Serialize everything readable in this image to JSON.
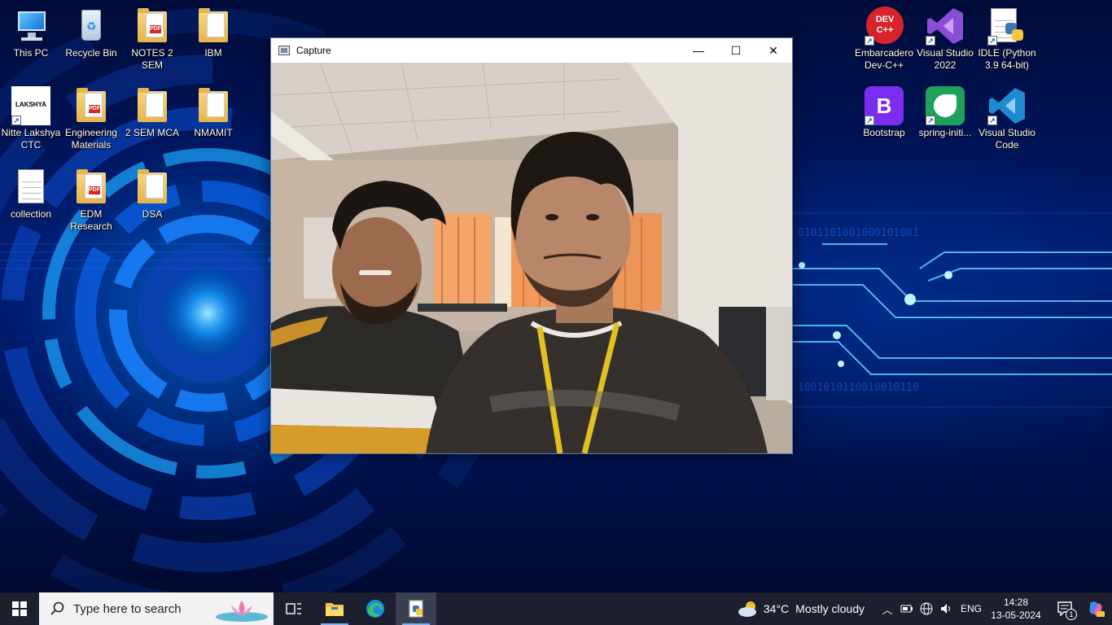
{
  "desktop": {
    "left_icons": [
      {
        "label": "This PC",
        "icon": "this-pc-icon"
      },
      {
        "label": "Recycle Bin",
        "icon": "recycle-bin-icon"
      },
      {
        "label": "NOTES 2 SEM",
        "icon": "pdf-folder-icon"
      },
      {
        "label": "IBM",
        "icon": "folder-icon"
      },
      {
        "label": "Nitte Lakshya CTC",
        "icon": "lakshya-shortcut-icon",
        "logo_text": "LAKSHYA"
      },
      {
        "label": "Engineering Materials",
        "icon": "pdf-folder-icon"
      },
      {
        "label": "2 SEM MCA",
        "icon": "folder-icon"
      },
      {
        "label": "NMAMIT",
        "icon": "folder-icon"
      },
      {
        "label": "collection",
        "icon": "text-file-icon"
      },
      {
        "label": "EDM Research",
        "icon": "pdf-folder-icon"
      },
      {
        "label": "DSA",
        "icon": "folder-icon"
      }
    ],
    "right_icons": [
      {
        "label": "Embarcadero Dev-C++",
        "icon": "devcpp-icon",
        "logo_text": "DEV C++"
      },
      {
        "label": "Visual Studio 2022",
        "icon": "visual-studio-icon"
      },
      {
        "label": "IDLE (Python 3.9 64-bit)",
        "icon": "python-idle-icon"
      },
      {
        "label": "Bootstrap",
        "icon": "bootstrap-icon",
        "logo_text": "B"
      },
      {
        "label": "spring-initi...",
        "icon": "spring-icon"
      },
      {
        "label": "Visual Studio Code",
        "icon": "vscode-icon"
      }
    ]
  },
  "window": {
    "title": "Capture",
    "minimize": "—",
    "maximize": "☐",
    "close": "✕",
    "content": "webcam-feed"
  },
  "taskbar": {
    "search_placeholder": "Type here to search",
    "pinned": [
      "task-view-icon",
      "file-explorer-icon",
      "edge-icon",
      "python-icon"
    ],
    "weather": {
      "temp": "34°C",
      "condition": "Mostly cloudy"
    },
    "language": "ENG",
    "time": "14:28",
    "date": "13-05-2024",
    "notification_count": "1"
  },
  "colors": {
    "taskbar": "#1c1f2e",
    "accent": "#7fb1f5",
    "wallpaper": "#001a6e"
  }
}
